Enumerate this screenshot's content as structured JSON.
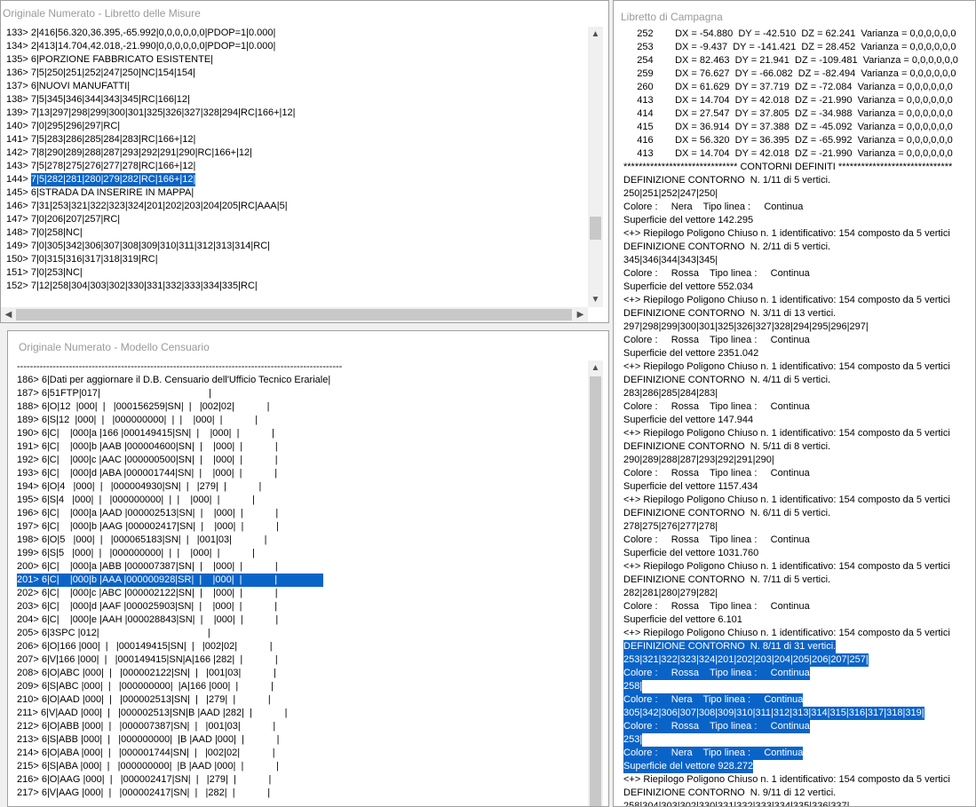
{
  "misure": {
    "title": "Originale Numerato - Libretto delle Misure",
    "selected_index": 11,
    "lines": [
      "133> 2|416|56.320,36.395,-65.992|0,0,0,0,0,0|PDOP=1|0.000|",
      "134> 2|413|14.704,42.018,-21.990|0,0,0,0,0,0|PDOP=1|0.000|",
      "135> 6|PORZIONE FABBRICATO ESISTENTE|",
      "136> 7|5|250|251|252|247|250|NC|154|154|",
      "137> 6|NUOVI MANUFATTI|",
      "138> 7|5|345|346|344|343|345|RC|166|12|",
      "139> 7|13|297|298|299|300|301|325|326|327|328|294|RC|166+|12|",
      "140> 7|0|295|296|297|RC|",
      "141> 7|5|283|286|285|284|283|RC|166+|12|",
      "142> 7|8|290|289|288|287|293|292|291|290|RC|166+|12|",
      "143> 7|5|278|275|276|277|278|RC|166+|12|",
      "144> 7|5|282|281|280|279|282|RC|166+|12|",
      "145> 6|STRADA DA INSERIRE IN MAPPA|",
      "146> 7|31|253|321|322|323|324|201|202|203|204|205|RC|AAA|5|",
      "147> 7|0|206|207|257|RC|",
      "148> 7|0|258|NC|",
      "149> 7|0|305|342|306|307|308|309|310|311|312|313|314|RC|",
      "150> 7|0|315|316|317|318|319|RC|",
      "151> 7|0|253|NC|",
      "152> 7|12|258|304|303|302|330|331|332|333|334|335|RC|"
    ]
  },
  "censuario": {
    "title": "Originale Numerato - Modello Censuario",
    "selected_index": 16,
    "lines": [
      "----------------------------------------------------------------------------------------------------",
      "186> 6|Dati per aggiornare il D.B. Censuario dell'Ufficio Tecnico Erariale|",
      "187> 6|51FTP|017|                                        |",
      "188> 6|O|12  |000|  |   |000156259|SN|  |   |002|02|            |",
      "189> 6|S|12  |000|  |   |000000000|  |  |    |000|  |            |",
      "190> 6|C|    |000|a |166 |000149415|SN|  |    |000|  |            |",
      "191> 6|C|    |000|b |AAB |000004600|SN|  |    |000|  |            |",
      "192> 6|C|    |000|c |AAC |000000500|SN|  |    |000|  |            |",
      "193> 6|C|    |000|d |ABA |000001744|SN|  |    |000|  |            |",
      "194> 6|O|4   |000|  |   |000004930|SN|  |   |279|  |            |",
      "195> 6|S|4   |000|  |   |000000000|  |  |    |000|  |            |",
      "196> 6|C|    |000|a |AAD |000002513|SN|  |    |000|  |            |",
      "197> 6|C|    |000|b |AAG |000002417|SN|  |    |000|  |            |",
      "198> 6|O|5   |000|  |   |000065183|SN|  |   |001|03|            |",
      "199> 6|S|5   |000|  |   |000000000|  |  |    |000|  |            |",
      "200> 6|C|    |000|a |ABB |000007387|SN|  |    |000|  |            |",
      "201> 6|C|    |000|b |AAA |000000928|SR|  |    |000|  |            |",
      "202> 6|C|    |000|c |ABC |000002122|SN|  |    |000|  |            |",
      "203> 6|C|    |000|d |AAF |000025903|SN|  |    |000|  |            |",
      "204> 6|C|    |000|e |AAH |000028843|SN|  |    |000|  |            |",
      "205> 6|3SPC |012|                                        |",
      "206> 6|O|166 |000|  |   |000149415|SN|  |   |002|02|            |",
      "207> 6|V|166 |000|  |   |000149415|SN|A|166 |282|  |            |",
      "208> 6|O|ABC |000|  |   |000002122|SN|  |   |001|03|            |",
      "209> 6|S|ABC |000|  |   |000000000|  |A|166 |000|  |            |",
      "210> 6|O|AAD |000|  |   |000002513|SN|  |   |279|  |            |",
      "211> 6|V|AAD |000|  |   |000002513|SN|B |AAD |282|  |            |",
      "212> 6|O|ABB |000|  |   |000007387|SN|  |   |001|03|            |",
      "213> 6|S|ABB |000|  |   |000000000|  |B |AAD |000|  |            |",
      "214> 6|O|ABA |000|  |   |000001744|SN|  |   |002|02|            |",
      "215> 6|S|ABA |000|  |   |000000000|  |B |AAD |000|  |            |",
      "216> 6|O|AAG |000|  |   |000002417|SN|  |   |279|  |            |",
      "217> 6|V|AAG |000|  |   |000002417|SN|  |   |282|  |            |"
    ]
  },
  "campagna": {
    "title": "Libretto di Campagna",
    "lines": [
      {
        "t": "     252        DX = -54.880  DY = -42.510  DZ = 62.241  Varianza = 0,0,0,0,0,0",
        "h": false
      },
      {
        "t": "     253        DX = -9.437  DY = -141.421  DZ = 28.452  Varianza = 0,0,0,0,0,0",
        "h": false
      },
      {
        "t": "     254        DX = 82.463  DY = 21.941  DZ = -109.481  Varianza = 0,0,0,0,0,0",
        "h": false
      },
      {
        "t": "     259        DX = 76.627  DY = -66.082  DZ = -82.494  Varianza = 0,0,0,0,0,0",
        "h": false
      },
      {
        "t": "     260        DX = 61.629  DY = 37.719  DZ = -72.084  Varianza = 0,0,0,0,0,0",
        "h": false
      },
      {
        "t": "     413        DX = 14.704  DY = 42.018  DZ = -21.990  Varianza = 0,0,0,0,0,0",
        "h": false
      },
      {
        "t": "     414        DX = 27.547  DY = 37.805  DZ = -34.988  Varianza = 0,0,0,0,0,0",
        "h": false
      },
      {
        "t": "     415        DX = 36.914  DY = 37.388  DZ = -45.092  Varianza = 0,0,0,0,0,0",
        "h": false
      },
      {
        "t": "     416        DX = 56.320  DY = 36.395  DZ = -65.992  Varianza = 0,0,0,0,0,0",
        "h": false
      },
      {
        "t": "     413        DX = 14.704  DY = 42.018  DZ = -21.990  Varianza = 0,0,0,0,0,0",
        "h": false
      },
      {
        "t": "****************************** CONTORNI DEFINITI ******************************",
        "h": false
      },
      {
        "t": "DEFINIZIONE CONTORNO  N. 1/11 di 5 vertici.",
        "h": false
      },
      {
        "t": "250|251|252|247|250|",
        "h": false
      },
      {
        "t": "Colore :     Nera    Tipo linea :     Continua",
        "h": false
      },
      {
        "t": "Superficie del vettore 142.295",
        "h": false
      },
      {
        "t": "<+> Riepilogo Poligono Chiuso n. 1 identificativo: 154 composto da 5 vertici",
        "h": false
      },
      {
        "t": "DEFINIZIONE CONTORNO  N. 2/11 di 5 vertici.",
        "h": false
      },
      {
        "t": "345|346|344|343|345|",
        "h": false
      },
      {
        "t": "Colore :     Rossa    Tipo linea :     Continua",
        "h": false
      },
      {
        "t": "Superficie del vettore 552.034",
        "h": false
      },
      {
        "t": "<+> Riepilogo Poligono Chiuso n. 1 identificativo: 154 composto da 5 vertici",
        "h": false
      },
      {
        "t": "DEFINIZIONE CONTORNO  N. 3/11 di 13 vertici.",
        "h": false
      },
      {
        "t": "297|298|299|300|301|325|326|327|328|294|295|296|297|",
        "h": false
      },
      {
        "t": "Colore :     Rossa    Tipo linea :     Continua",
        "h": false
      },
      {
        "t": "Superficie del vettore 2351.042",
        "h": false
      },
      {
        "t": "<+> Riepilogo Poligono Chiuso n. 1 identificativo: 154 composto da 5 vertici",
        "h": false
      },
      {
        "t": "DEFINIZIONE CONTORNO  N. 4/11 di 5 vertici.",
        "h": false
      },
      {
        "t": "283|286|285|284|283|",
        "h": false
      },
      {
        "t": "Colore :     Rossa    Tipo linea :     Continua",
        "h": false
      },
      {
        "t": "Superficie del vettore 147.944",
        "h": false
      },
      {
        "t": "<+> Riepilogo Poligono Chiuso n. 1 identificativo: 154 composto da 5 vertici",
        "h": false
      },
      {
        "t": "DEFINIZIONE CONTORNO  N. 5/11 di 8 vertici.",
        "h": false
      },
      {
        "t": "290|289|288|287|293|292|291|290|",
        "h": false
      },
      {
        "t": "Colore :     Rossa    Tipo linea :     Continua",
        "h": false
      },
      {
        "t": "Superficie del vettore 1157.434",
        "h": false
      },
      {
        "t": "<+> Riepilogo Poligono Chiuso n. 1 identificativo: 154 composto da 5 vertici",
        "h": false
      },
      {
        "t": "DEFINIZIONE CONTORNO  N. 6/11 di 5 vertici.",
        "h": false
      },
      {
        "t": "278|275|276|277|278|",
        "h": false
      },
      {
        "t": "Colore :     Rossa    Tipo linea :     Continua",
        "h": false
      },
      {
        "t": "Superficie del vettore 1031.760",
        "h": false
      },
      {
        "t": "<+> Riepilogo Poligono Chiuso n. 1 identificativo: 154 composto da 5 vertici",
        "h": false
      },
      {
        "t": "DEFINIZIONE CONTORNO  N. 7/11 di 5 vertici.",
        "h": false
      },
      {
        "t": "282|281|280|279|282|",
        "h": false
      },
      {
        "t": "Colore :     Rossa    Tipo linea :     Continua",
        "h": false
      },
      {
        "t": "Superficie del vettore 6.101",
        "h": false
      },
      {
        "t": "<+> Riepilogo Poligono Chiuso n. 1 identificativo: 154 composto da 5 vertici",
        "h": false
      },
      {
        "t": "DEFINIZIONE CONTORNO  N. 8/11 di 31 vertici.",
        "h": true
      },
      {
        "t": "253|321|322|323|324|201|202|203|204|205|206|207|257|",
        "h": true
      },
      {
        "t": "Colore :     Rossa    Tipo linea :     Continua",
        "h": true
      },
      {
        "t": "258|",
        "h": true
      },
      {
        "t": "Colore :     Nera    Tipo linea :     Continua",
        "h": true
      },
      {
        "t": "305|342|306|307|308|309|310|311|312|313|314|315|316|317|318|319|",
        "h": true
      },
      {
        "t": "Colore :     Rossa    Tipo linea :     Continua",
        "h": true
      },
      {
        "t": "253|",
        "h": true
      },
      {
        "t": "Colore :     Nera    Tipo linea :     Continua",
        "h": true
      },
      {
        "t": "Superficie del vettore 928.272",
        "h": true
      },
      {
        "t": "<+> Riepilogo Poligono Chiuso n. 1 identificativo: 154 composto da 5 vertici",
        "h": false
      },
      {
        "t": "DEFINIZIONE CONTORNO  N. 9/11 di 12 vertici.",
        "h": false
      },
      {
        "t": "258|304|303|302|330|331|332|333|334|335|336|337|",
        "h": false
      }
    ]
  },
  "icons": {
    "up": "▲",
    "down": "▼",
    "left": "◀",
    "right": "▶"
  }
}
